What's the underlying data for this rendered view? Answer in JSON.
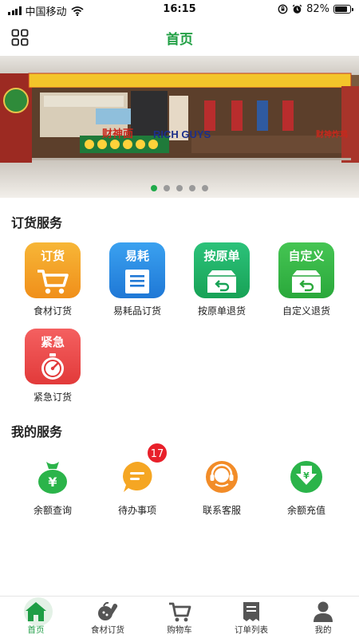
{
  "status_bar": {
    "carrier": "中国移动",
    "time": "16:15",
    "battery": "82%",
    "battery_level": 0.82
  },
  "header": {
    "title": "首页",
    "menu_icon": "grid-icon"
  },
  "banner": {
    "sign_cn_left": "财神面",
    "sign_en": "RICH GUYS",
    "sign_cn_right": "财神炸鸡",
    "page_count": 5,
    "active_page": 1
  },
  "order_service": {
    "title": "订货服务",
    "items": [
      {
        "icon_text": "订货",
        "label": "食材订货",
        "icon": "cart-icon",
        "color": "#f5a623"
      },
      {
        "icon_text": "易耗",
        "label": "易耗品订货",
        "icon": "document-icon",
        "color": "#2a8de6"
      },
      {
        "icon_text": "按原单",
        "label": "按原单退货",
        "icon": "return-box-icon",
        "color": "#22b36a"
      },
      {
        "icon_text": "自定义",
        "label": "自定义退货",
        "icon": "return-box-icon",
        "color": "#35b843"
      },
      {
        "icon_text": "紧急",
        "label": "紧急订货",
        "icon": "stopwatch-icon",
        "color": "#ef4c4c"
      }
    ]
  },
  "my_service": {
    "title": "我的服务",
    "items": [
      {
        "label": "余额查询",
        "icon": "money-bag-icon",
        "color": "#2bb44a"
      },
      {
        "label": "待办事项",
        "icon": "chat-bubble-icon",
        "color": "#f5a623",
        "badge": "17"
      },
      {
        "label": "联系客服",
        "icon": "headset-icon",
        "color": "#f28c28"
      },
      {
        "label": "余额充值",
        "icon": "recharge-icon",
        "color": "#2bb44a"
      }
    ]
  },
  "tabbar": {
    "items": [
      {
        "label": "首页",
        "icon": "home-icon",
        "active": true
      },
      {
        "label": "食材订货",
        "icon": "vegetables-icon",
        "active": false
      },
      {
        "label": "购物车",
        "icon": "cart-icon",
        "active": false
      },
      {
        "label": "订单列表",
        "icon": "receipt-icon",
        "active": false
      },
      {
        "label": "我的",
        "icon": "user-icon",
        "active": false
      }
    ]
  },
  "colors": {
    "accent": "#22a045",
    "badge": "#e8202a"
  }
}
